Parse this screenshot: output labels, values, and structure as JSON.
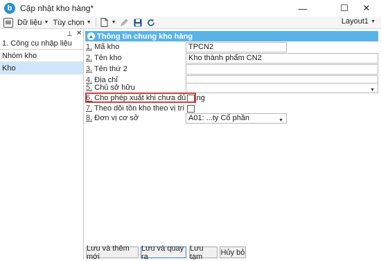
{
  "window": {
    "title": "Cập nhật kho hàng*",
    "logo_letter": "b",
    "minimize": "—",
    "maximize": "☐",
    "close": "✕"
  },
  "toolbar": {
    "data_menu": "Dữ liệu",
    "options_menu": "Tùy chọn",
    "layout_value": "Layout1"
  },
  "left_panel": {
    "pin": "ᵖ",
    "close": "✕",
    "header": "1. Công cụ nhập liệu",
    "items": [
      {
        "label": "Nhóm kho",
        "selected": false
      },
      {
        "label": "Kho",
        "selected": true
      }
    ]
  },
  "section": {
    "title": "Thông tin chung kho hàng",
    "toggle": "⌃"
  },
  "fields": [
    {
      "num": "1.",
      "label": "Mã kho",
      "value": "TPCN2",
      "type": "text"
    },
    {
      "num": "2.",
      "label": "Tên kho",
      "value": "Kho thành phẩm CN2",
      "type": "text-wide"
    },
    {
      "num": "3.",
      "label": "Tên thứ 2",
      "value": "",
      "type": "text-wide"
    },
    {
      "num": "4.",
      "label": "Địa chỉ",
      "value": "",
      "type": "text-wide"
    },
    {
      "num": "5.",
      "label": "Chủ sở hữu",
      "value": "",
      "type": "select-wide"
    },
    {
      "num": "6.",
      "label": "Cho phép xuất khi chưa đủ hàng",
      "checked": false,
      "type": "checkbox"
    },
    {
      "num": "7.",
      "label": "Theo dõi tồn kho theo vị trí",
      "checked": false,
      "type": "checkbox"
    },
    {
      "num": "8.",
      "label": "Đơn vị cơ sở",
      "value": "A01: ...ty Cổ phần",
      "type": "select"
    }
  ],
  "buttons": {
    "save_new": "Lưu và thêm mới",
    "save_back": "Lưu và quay ra",
    "save_temp": "Lưu tạm",
    "cancel": "Hủy bỏ"
  },
  "colors": {
    "section_header": "#5ab2e8",
    "selected_row": "#cfe6fb",
    "highlight": "#d23b3b"
  }
}
